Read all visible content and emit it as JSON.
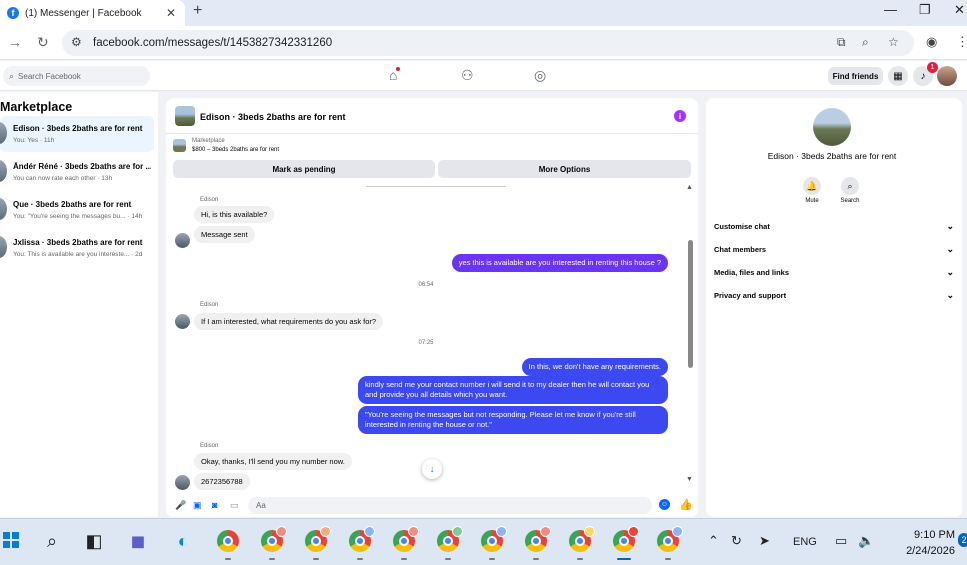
{
  "browser": {
    "tab_title": "(1) Messenger | Facebook",
    "tab_favicon": "facebook-icon",
    "url": "facebook.com/messages/t/1453827342331260"
  },
  "fb_header": {
    "search_placeholder": "Search Facebook",
    "find_friends": "Find friends",
    "notification_count": "1"
  },
  "sidebar": {
    "title": "Marketplace",
    "conversations": [
      {
        "name": "Edison · 3beds 2baths are for rent",
        "preview": "You: Yes · 11h",
        "active": true
      },
      {
        "name": "Ândér Réné · 3beds 2baths are for ...",
        "preview": "You can now rate each other · 13h",
        "active": false
      },
      {
        "name": "Que · 3beds 2baths are for rent",
        "preview": "You: \"You're seeing the messages bu... · 14h",
        "active": false
      },
      {
        "name": "Jxlissa · 3beds 2baths are for rent",
        "preview": "You: This is available are you intereste... · 2d",
        "active": false
      }
    ]
  },
  "chat": {
    "header_name": "Edison · 3beds 2baths are for rent",
    "marketplace_label": "Marketplace",
    "listing": "$800 – 3beds 2baths are for rent",
    "mark_pending": "Mark as pending",
    "more_options": "More Options",
    "messages": [
      {
        "type": "sender",
        "text": "Edison"
      },
      {
        "type": "in",
        "text": "Hi, is this available?"
      },
      {
        "type": "in",
        "text": "Message sent"
      },
      {
        "type": "out",
        "text": "yes this is available are you interested in renting this house ?"
      },
      {
        "type": "time",
        "text": "06:54"
      },
      {
        "type": "sender",
        "text": "Edison"
      },
      {
        "type": "in",
        "text": "If I am interested, what requirements do you ask for?"
      },
      {
        "type": "time",
        "text": "07:25"
      },
      {
        "type": "out",
        "text": "In this, we don't have any requirements."
      },
      {
        "type": "out",
        "text": "kindly send me your contact number i will send it to my dealer then he will contact you and provide you all details which you want."
      },
      {
        "type": "out",
        "text": "\"You're seeing the messages but not responding. Please let me know if you're still interested in renting the house or not.\""
      },
      {
        "type": "sender",
        "text": "Edison"
      },
      {
        "type": "in",
        "text": "Okay, thanks, I'll send you my number now."
      },
      {
        "type": "in",
        "text": "2672356788"
      }
    ],
    "composer_placeholder": "Aa"
  },
  "info_panel": {
    "name": "Edison · 3beds 2baths are for rent",
    "mute_label": "Mute",
    "search_label": "Search",
    "sections": [
      "Customise chat",
      "Chat members",
      "Media, files and links",
      "Privacy and support"
    ]
  },
  "taskbar": {
    "language": "ENG",
    "time": "9:10 PM",
    "date": "2/24/2026",
    "notification_count": "2"
  },
  "colors": {
    "accent_purple": "#6b34f5",
    "accent_blue": "#3c49f0",
    "fb_blue": "#0866ff"
  }
}
